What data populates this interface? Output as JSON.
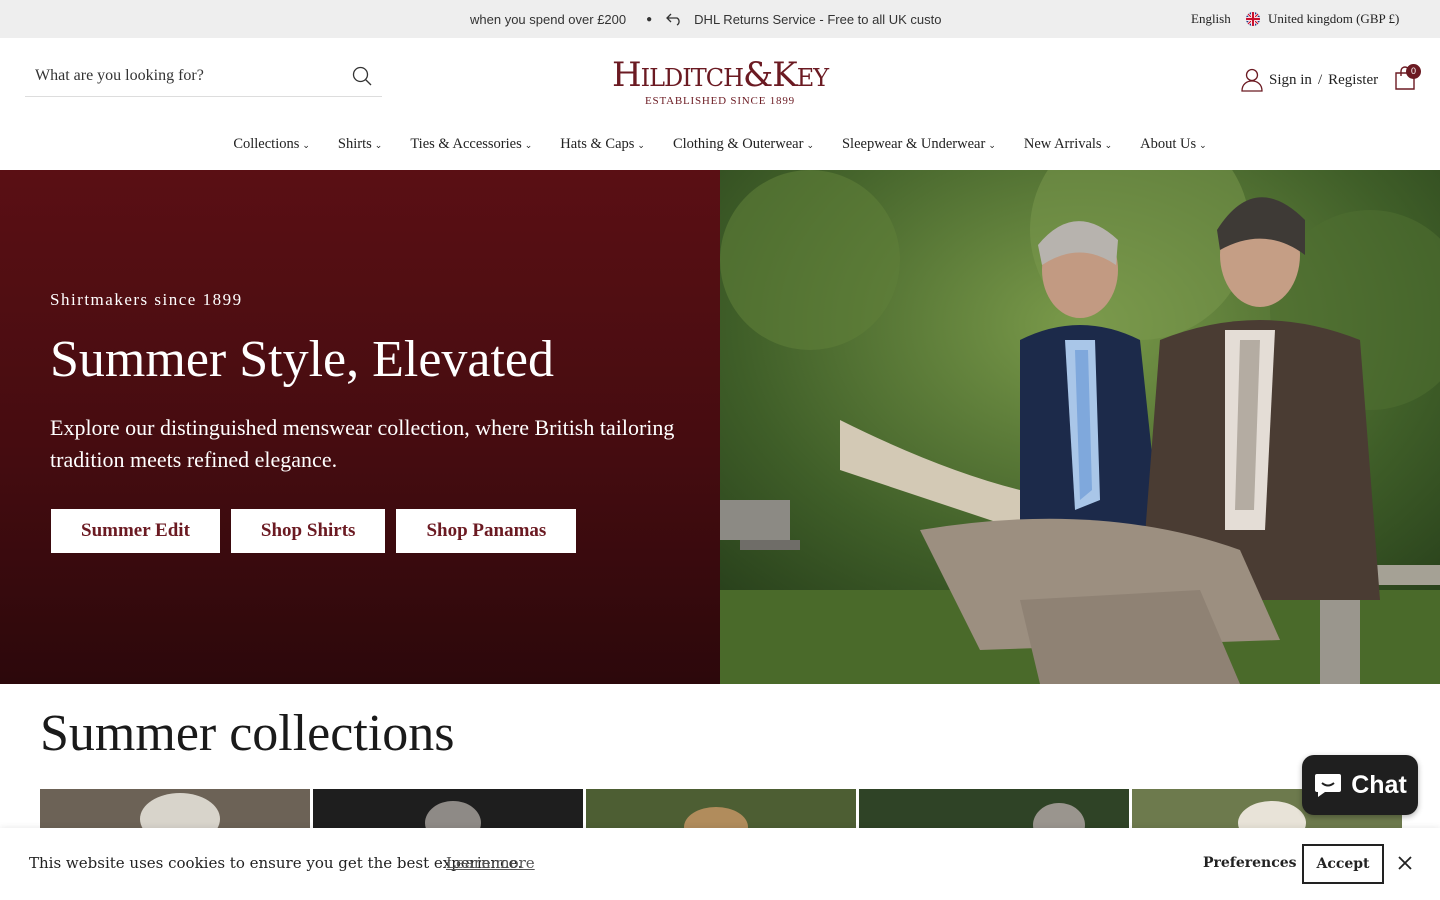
{
  "announcement": {
    "messages": [
      "when you spend over £200",
      "DHL Returns Service - Free to all UK custo"
    ],
    "language": "English",
    "region": "United kingdom (GBP £)"
  },
  "header": {
    "search_placeholder": "What are you looking for?",
    "logo_brand": "Hilditch&Key",
    "logo_tagline": "ESTABLISHED SINCE 1899",
    "sign_in": "Sign in",
    "separator": "/",
    "register": "Register",
    "cart_count": "0"
  },
  "nav": {
    "items": [
      {
        "label": "Collections"
      },
      {
        "label": "Shirts"
      },
      {
        "label": "Ties & Accessories"
      },
      {
        "label": "Hats & Caps"
      },
      {
        "label": "Clothing & Outerwear"
      },
      {
        "label": "Sleepwear & Underwear"
      },
      {
        "label": "New Arrivals"
      },
      {
        "label": "About Us"
      }
    ]
  },
  "hero": {
    "kicker": "Shirtmakers since 1899",
    "title": "Summer Style, Elevated",
    "description": "Explore our distinguished menswear collection, where British tailoring tradition meets refined elegance.",
    "buttons": [
      {
        "label": "Summer Edit"
      },
      {
        "label": "Shop Shirts"
      },
      {
        "label": "Shop Panamas"
      }
    ]
  },
  "collections": {
    "title": "Summer collections"
  },
  "chat": {
    "label": "Chat"
  },
  "cookie": {
    "message": "This website uses cookies to ensure you get the best experience.",
    "learn_more": "Learn more",
    "preferences": "Preferences",
    "accept": "Accept"
  },
  "colors": {
    "brand": "#6b1a22",
    "hero_bg": "#4a0d11",
    "announce_bg": "#eeeeee"
  }
}
